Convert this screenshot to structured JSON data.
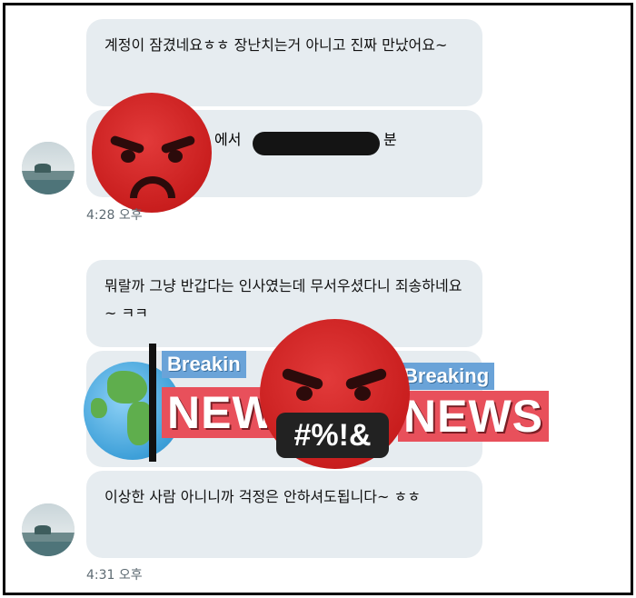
{
  "messages": {
    "m1_text": "계정이 잠겼네요ㅎㅎ 장난치는거 아니고 진짜 만났어요~",
    "m2_text_suffix": "에서",
    "m2_text_end": "분",
    "time1": "4:28 오후",
    "m3_text": "뭐랄까 그냥 반갑다는 인사였는데 무서우셨다니 죄송하네요~ ㅋㅋ",
    "m5_text": "이상한 사람 아니니까 걱정은 안하셔도됩니다~ ㅎㅎ",
    "time2": "4:31 오후"
  },
  "overlay": {
    "breaking_left": "Breakin",
    "breaking_right": "Breaking",
    "news_left": "NEW",
    "news_right": "NEWS",
    "censor_text": "#%!&"
  }
}
